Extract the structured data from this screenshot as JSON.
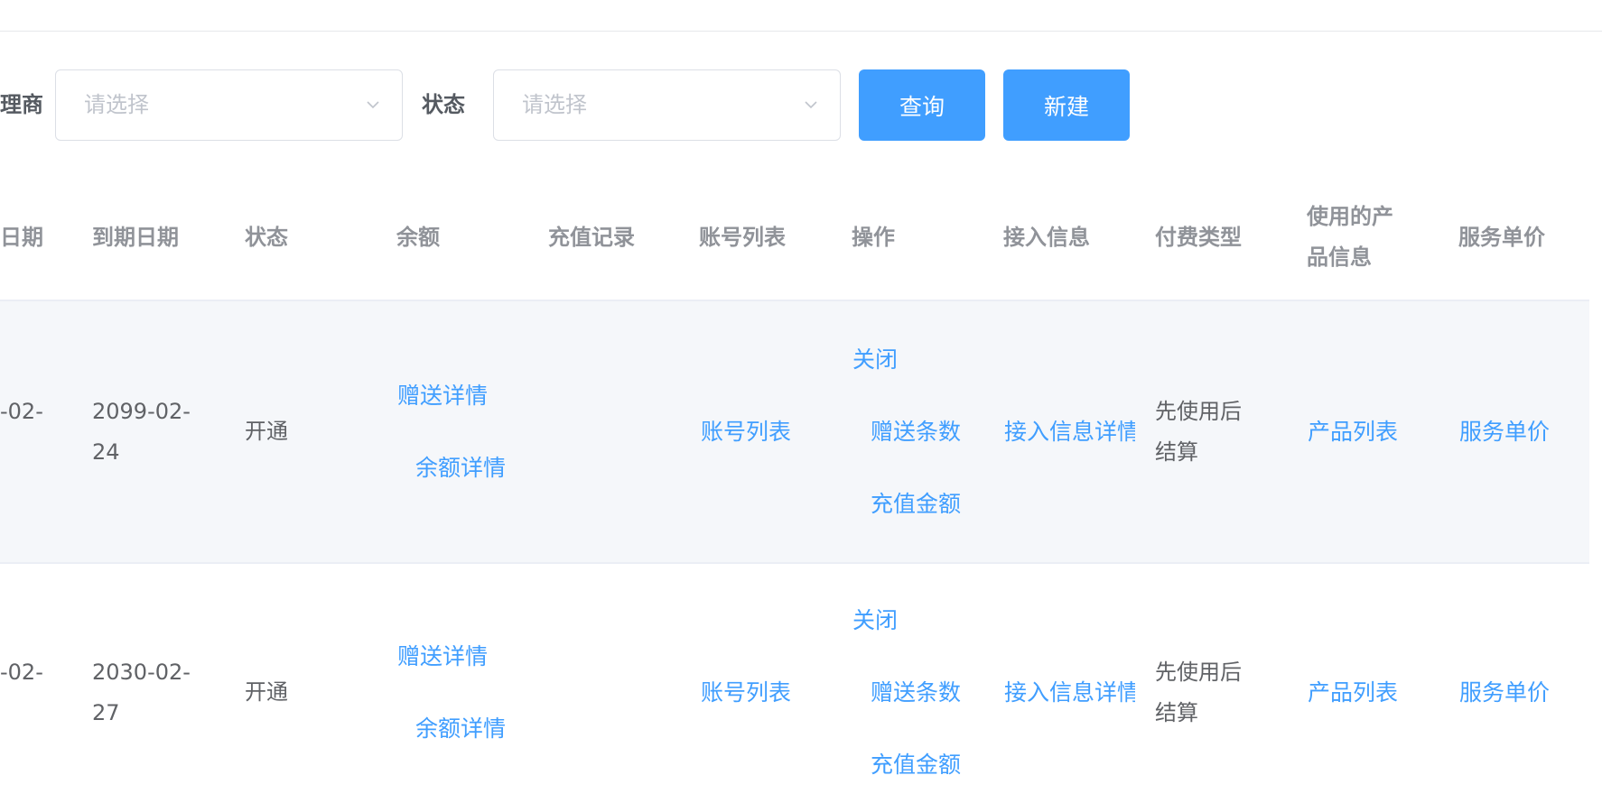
{
  "filters": {
    "agent_label": "理商",
    "agent_placeholder": "请选择",
    "status_label": "状态",
    "status_placeholder": "请选择",
    "query_button": "查询",
    "new_button": "新建"
  },
  "table": {
    "headers": {
      "start_date": "日期",
      "expire_date": "到期日期",
      "status": "状态",
      "balance": "余额",
      "recharge_records": "充值记录",
      "account_list": "账号列表",
      "actions": "操作",
      "access_info": "接入信息",
      "payment_type": "付费类型",
      "product_info_line1": "使用的产",
      "product_info_line2": "品信息",
      "service_price": "服务单价"
    },
    "rows": [
      {
        "start_date": "-02-",
        "expire_date_line1": "2099-02-",
        "expire_date_line2": "24",
        "status": "开通",
        "gift_detail": "赠送详情",
        "balance_detail": "余额详情",
        "account_list": "账号列表",
        "close": "关闭",
        "gift_count": "赠送条数",
        "recharge_amount": "充值金额",
        "access_info": "接入信息详情",
        "payment_line1": "先使用后",
        "payment_line2": "结算",
        "product_list": "产品列表",
        "service_price": "服务单价"
      },
      {
        "start_date": "-02-",
        "expire_date_line1": "2030-02-",
        "expire_date_line2": "27",
        "status": "开通",
        "gift_detail": "赠送详情",
        "balance_detail": "余额详情",
        "account_list": "账号列表",
        "close": "关闭",
        "gift_count": "赠送条数",
        "recharge_amount": "充值金额",
        "access_info": "接入信息详情",
        "payment_line1": "先使用后",
        "payment_line2": "结算",
        "product_list": "产品列表",
        "service_price": "服务单价"
      }
    ]
  },
  "colors": {
    "primary": "#409eff",
    "row_hover_bg": "#f5f7fa",
    "border": "#ebeef5"
  }
}
